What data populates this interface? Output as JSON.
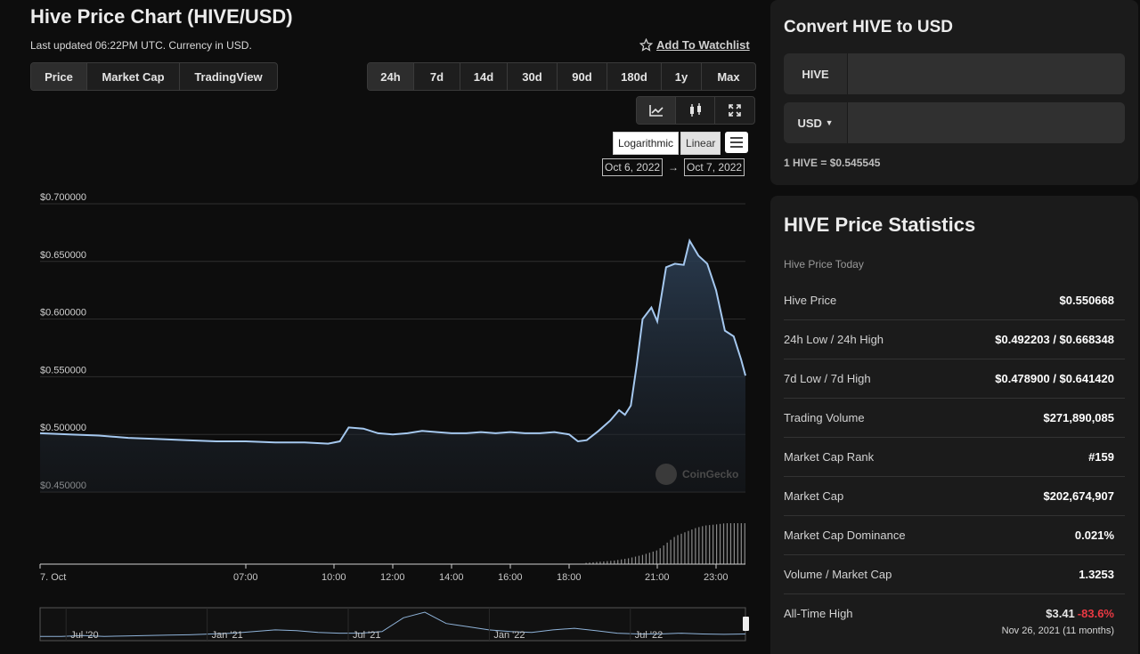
{
  "header": {
    "title": "Hive Price Chart (HIVE/USD)",
    "updated": "Last updated 06:22PM UTC. Currency in USD.",
    "watchlist": "Add To Watchlist"
  },
  "view_tabs": [
    "Price",
    "Market Cap",
    "TradingView"
  ],
  "range_tabs": [
    "24h",
    "7d",
    "14d",
    "30d",
    "90d",
    "180d",
    "1y",
    "Max"
  ],
  "chart_icons": [
    "line-chart-icon",
    "candlestick-icon",
    "fullscreen-icon"
  ],
  "scale": {
    "log": "Logarithmic",
    "linear": "Linear"
  },
  "date_range": {
    "from": "Oct 6, 2022",
    "arrow": "→",
    "to": "Oct 7, 2022"
  },
  "watermark": "CoinGecko",
  "chart_data": {
    "type": "area",
    "ylim": [
      0.45,
      0.7
    ],
    "yticks": [
      "$0.700000",
      "$0.650000",
      "$0.600000",
      "$0.550000",
      "$0.500000",
      "$0.450000"
    ],
    "yvalues": [
      0.7,
      0.65,
      0.6,
      0.55,
      0.5,
      0.45
    ],
    "xticks": [
      "7. Oct",
      "07:00",
      "10:00",
      "12:00",
      "14:00",
      "16:00",
      "18:00",
      "21:00",
      "23:00"
    ],
    "xtick_hours": [
      0,
      7,
      10,
      12,
      14,
      16,
      18,
      21,
      23
    ],
    "xlim_hours": [
      0,
      24
    ],
    "series": [
      {
        "hours": [
          0,
          1,
          2,
          3,
          4,
          5,
          6,
          7,
          8,
          9,
          9.8,
          10.2,
          10.5,
          11,
          11.5,
          12,
          12.5,
          13,
          13.5,
          14,
          14.5,
          15,
          15.5,
          16,
          16.5,
          17,
          17.5,
          18,
          18.3,
          18.6,
          19,
          19.4,
          19.7,
          19.9,
          20.1,
          20.3,
          20.5,
          20.8,
          21,
          21.3,
          21.6,
          21.9,
          22.1,
          22.4,
          22.7,
          23,
          23.3,
          23.6,
          23.85,
          24
        ],
        "values": [
          0.501,
          0.5,
          0.499,
          0.497,
          0.496,
          0.495,
          0.494,
          0.494,
          0.493,
          0.493,
          0.492,
          0.494,
          0.506,
          0.505,
          0.501,
          0.5,
          0.501,
          0.503,
          0.502,
          0.501,
          0.501,
          0.502,
          0.501,
          0.502,
          0.501,
          0.501,
          0.502,
          0.5,
          0.494,
          0.495,
          0.503,
          0.512,
          0.521,
          0.517,
          0.525,
          0.56,
          0.6,
          0.61,
          0.598,
          0.645,
          0.648,
          0.647,
          0.668,
          0.655,
          0.648,
          0.625,
          0.59,
          0.585,
          0.565,
          0.551
        ]
      }
    ],
    "volume_hours": [
      18.5,
      19,
      19.5,
      20,
      20.5,
      21,
      21.3,
      21.6,
      22,
      22.3,
      22.6,
      23,
      23.3,
      23.6,
      24
    ],
    "volume_values": [
      1,
      2,
      3,
      5,
      8,
      12,
      18,
      24,
      28,
      31,
      33,
      34,
      35,
      35,
      35
    ]
  },
  "navigator": {
    "labels": [
      "Jul '20",
      "Jan '21",
      "Jul '21",
      "Jan '22",
      "Jul '22"
    ],
    "values": [
      0.2,
      0.2,
      0.3,
      0.2,
      0.25,
      0.3,
      0.35,
      0.4,
      0.5,
      0.6,
      0.8,
      1.0,
      0.9,
      0.7,
      0.6,
      0.6,
      0.8,
      2.5,
      3.2,
      1.8,
      1.4,
      1.0,
      0.8,
      0.7,
      1.0,
      1.2,
      0.9,
      0.6,
      0.5,
      0.5,
      0.6,
      0.5,
      0.45,
      0.5
    ]
  },
  "convert": {
    "title": "Convert HIVE to USD",
    "from_label": "HIVE",
    "to_label": "USD",
    "from_value": "",
    "to_value": "",
    "rate": "1 HIVE = $0.545545"
  },
  "stats": {
    "title": "HIVE Price Statistics",
    "subtitle": "Hive Price Today",
    "rows": [
      {
        "k": "Hive Price",
        "v": "$0.550668"
      },
      {
        "k": "24h Low / 24h High",
        "v": "$0.492203 / $0.668348"
      },
      {
        "k": "7d Low / 7d High",
        "v": "$0.478900 / $0.641420"
      },
      {
        "k": "Trading Volume",
        "v": "$271,890,085"
      },
      {
        "k": "Market Cap Rank",
        "v": "#159"
      },
      {
        "k": "Market Cap",
        "v": "$202,674,907"
      },
      {
        "k": "Market Cap Dominance",
        "v": "0.021%"
      },
      {
        "k": "Volume / Market Cap",
        "v": "1.3253"
      }
    ],
    "ath": {
      "k": "All-Time High",
      "v": "$3.41",
      "change": "-83.6%",
      "date": "Nov 26, 2021 (11 months)"
    }
  },
  "colors": {
    "line": "#a5c8ef",
    "negative": "#ea3943"
  }
}
